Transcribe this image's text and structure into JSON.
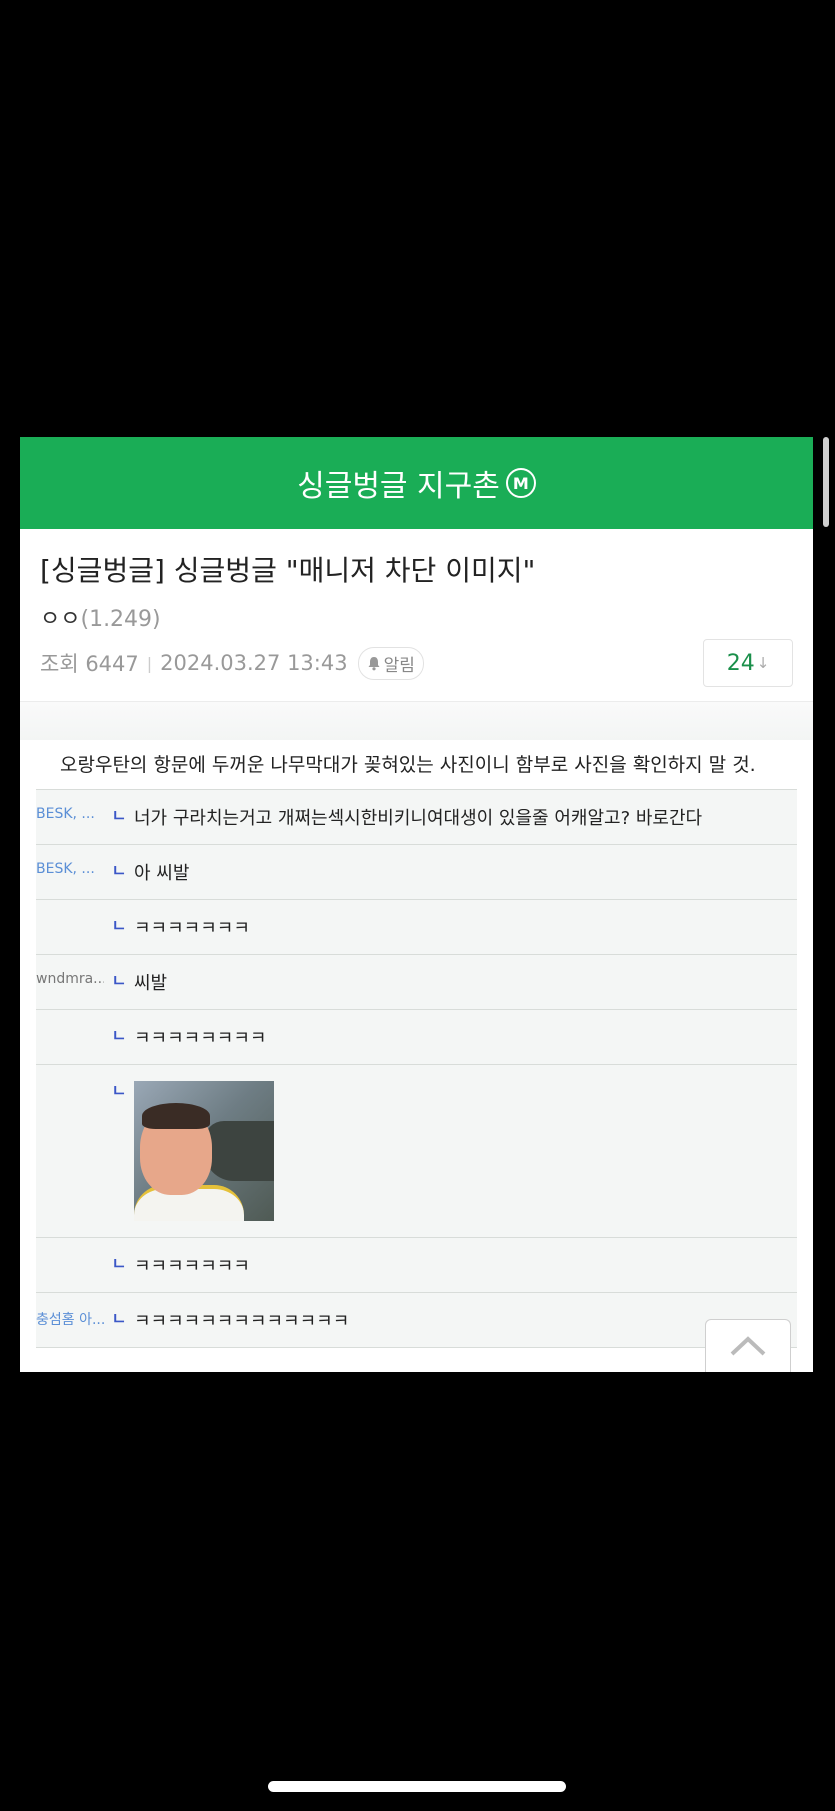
{
  "header": {
    "board_name": "싱글벙글 지구촌",
    "badge": "M"
  },
  "post": {
    "title": "[싱글벙글] 싱글벙글 \"매니저 차단 이미지\"",
    "author": "ㅇㅇ",
    "author_level": "(1.249)",
    "views_label": "조회 6447",
    "date": "2024.03.27 13:43",
    "alarm_label": "알림",
    "comment_count": "24",
    "comment_arrow": "↓"
  },
  "warning_text": "오랑우탄의 항문에 두꺼운 나무막대가 꽂혀있는 사진이니 함부로 사진을 확인하지 말 것.",
  "reply_marker": "ㄴ",
  "comments": [
    {
      "nick": "BESK, ...",
      "text": "너가 구라치는거고 개쩌는섹시한비키니여대생이 있을줄 어캐알고? 바로간다"
    },
    {
      "nick": "BESK, ...",
      "text": "아 씨발"
    },
    {
      "nick": "",
      "text": "ㅋㅋㅋㅋㅋㅋㅋ"
    },
    {
      "nick": "wndmra...",
      "text": "씨발"
    },
    {
      "nick": "",
      "text": "ㅋㅋㅋㅋㅋㅋㅋㅋ"
    },
    {
      "nick": "",
      "text": ""
    },
    {
      "nick": "",
      "text": "ㅋㅋㅋㅋㅋㅋㅋ"
    },
    {
      "nick": "충섬홈 아...",
      "text": "ㅋㅋㅋㅋㅋㅋㅋㅋㅋㅋㅋㅋㅋ"
    }
  ],
  "icons": {
    "bell": "bell-icon",
    "scroll_top": "chevron-up-icon"
  },
  "colors": {
    "brand_green": "#1aad56",
    "count_green": "#1a8f4a",
    "reply_blue": "#3b57c7"
  }
}
